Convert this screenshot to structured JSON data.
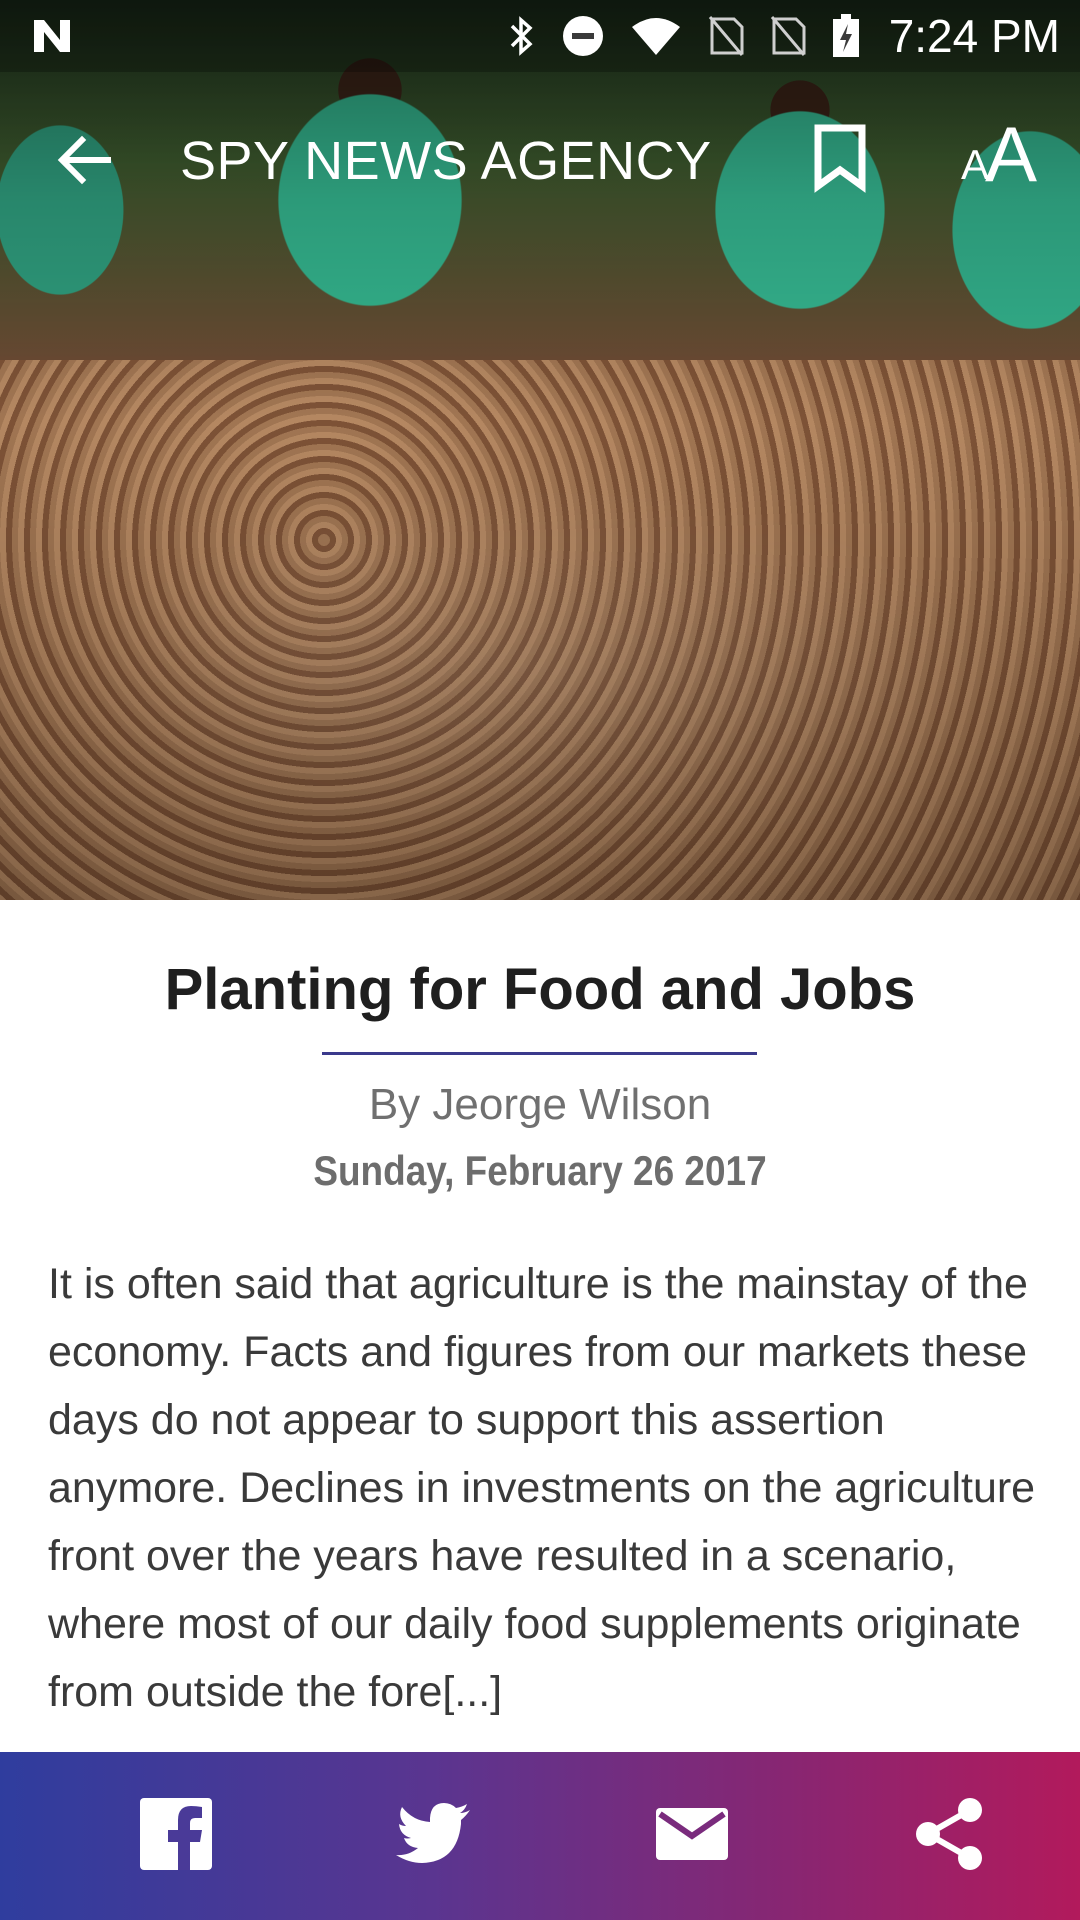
{
  "status_bar": {
    "time": "7:24 PM",
    "icons": [
      "notification-n-icon",
      "bluetooth-icon",
      "do-not-disturb-icon",
      "wifi-icon",
      "no-sim-icon",
      "no-sim-icon",
      "battery-charging-icon"
    ]
  },
  "app_bar": {
    "title": "SPY NEWS AGENCY",
    "back_icon": "arrow-back-icon",
    "bookmark_icon": "bookmark-icon",
    "font_size_small": "A",
    "font_size_large": "A"
  },
  "article": {
    "headline": "Planting for Food and Jobs",
    "byline": "By Jeorge Wilson",
    "date": "Sunday, February 26 2017",
    "body": "It is often said that agriculture is the mainstay of the economy. Facts and figures from our markets these days do not appear to support this assertion anymore. Declines in investments on the agriculture front over the years have resulted in a scenario, where most of our daily food supplements originate from outside the fore[...]"
  },
  "share_bar": {
    "icons": [
      "facebook-icon",
      "twitter-icon",
      "email-icon",
      "share-icon"
    ],
    "colors": {
      "start": "#2f3d9e",
      "end": "#b21a5c"
    }
  },
  "colors": {
    "headline_rule": "#3b3a8c",
    "headline_text": "#1f1f1f",
    "body_text": "#3a3a3a"
  }
}
